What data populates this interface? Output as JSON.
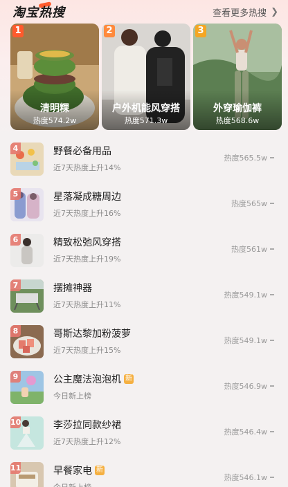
{
  "header": {
    "brand": "淘宝热搜",
    "more_label": "查看更多热搜",
    "more_icon": "chevron-right-icon"
  },
  "cards": [
    {
      "rank": "1",
      "title": "清明粿",
      "heat": "热度574.2w",
      "rank_color": "#ff5a2c"
    },
    {
      "rank": "2",
      "title": "户外机能风穿搭",
      "heat": "热度571.3w",
      "rank_color": "#ff8a3c"
    },
    {
      "rank": "3",
      "title": "外穿瑜伽裤",
      "heat": "热度568.6w",
      "rank_color": "#f5a623"
    }
  ],
  "list": [
    {
      "rank": "4",
      "name": "野餐必备用品",
      "sub": "近7天热度上升14%",
      "heat": "热度565.5w",
      "is_new": false
    },
    {
      "rank": "5",
      "name": "星落凝成糖周边",
      "sub": "近7天热度上升16%",
      "heat": "热度565w",
      "is_new": false
    },
    {
      "rank": "6",
      "name": "精致松弛风穿搭",
      "sub": "近7天热度上升19%",
      "heat": "热度561w",
      "is_new": false
    },
    {
      "rank": "7",
      "name": "摆摊神器",
      "sub": "近7天热度上升11%",
      "heat": "热度549.1w",
      "is_new": false
    },
    {
      "rank": "8",
      "name": "哥斯达黎加粉菠萝",
      "sub": "近7天热度上升15%",
      "heat": "热度549.1w",
      "is_new": false
    },
    {
      "rank": "9",
      "name": "公主魔法泡泡机",
      "sub": "今日新上榜",
      "heat": "热度546.9w",
      "is_new": true
    },
    {
      "rank": "10",
      "name": "李莎拉同款纱裙",
      "sub": "近7天热度上升12%",
      "heat": "热度546.4w",
      "is_new": false
    },
    {
      "rank": "11",
      "name": "早餐家电",
      "sub": "今日新上榜",
      "heat": "热度546.1w",
      "is_new": true
    }
  ],
  "new_badge": "新"
}
